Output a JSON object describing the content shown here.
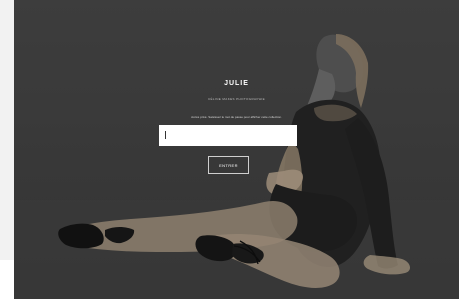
{
  "gallery": {
    "title": "JULIE",
    "subtitle": "CÉLINE MAKES PHOTOGRAPHIE",
    "instruction": "Accès privé. Saisissez le mot de passe pour afficher cette collection."
  },
  "password": {
    "value": "",
    "placeholder": ""
  },
  "enter_button": {
    "label": "ENTRER"
  },
  "colors": {
    "background": "#3b3b3b",
    "text": "#ffffff",
    "input_background": "#ffffff"
  }
}
